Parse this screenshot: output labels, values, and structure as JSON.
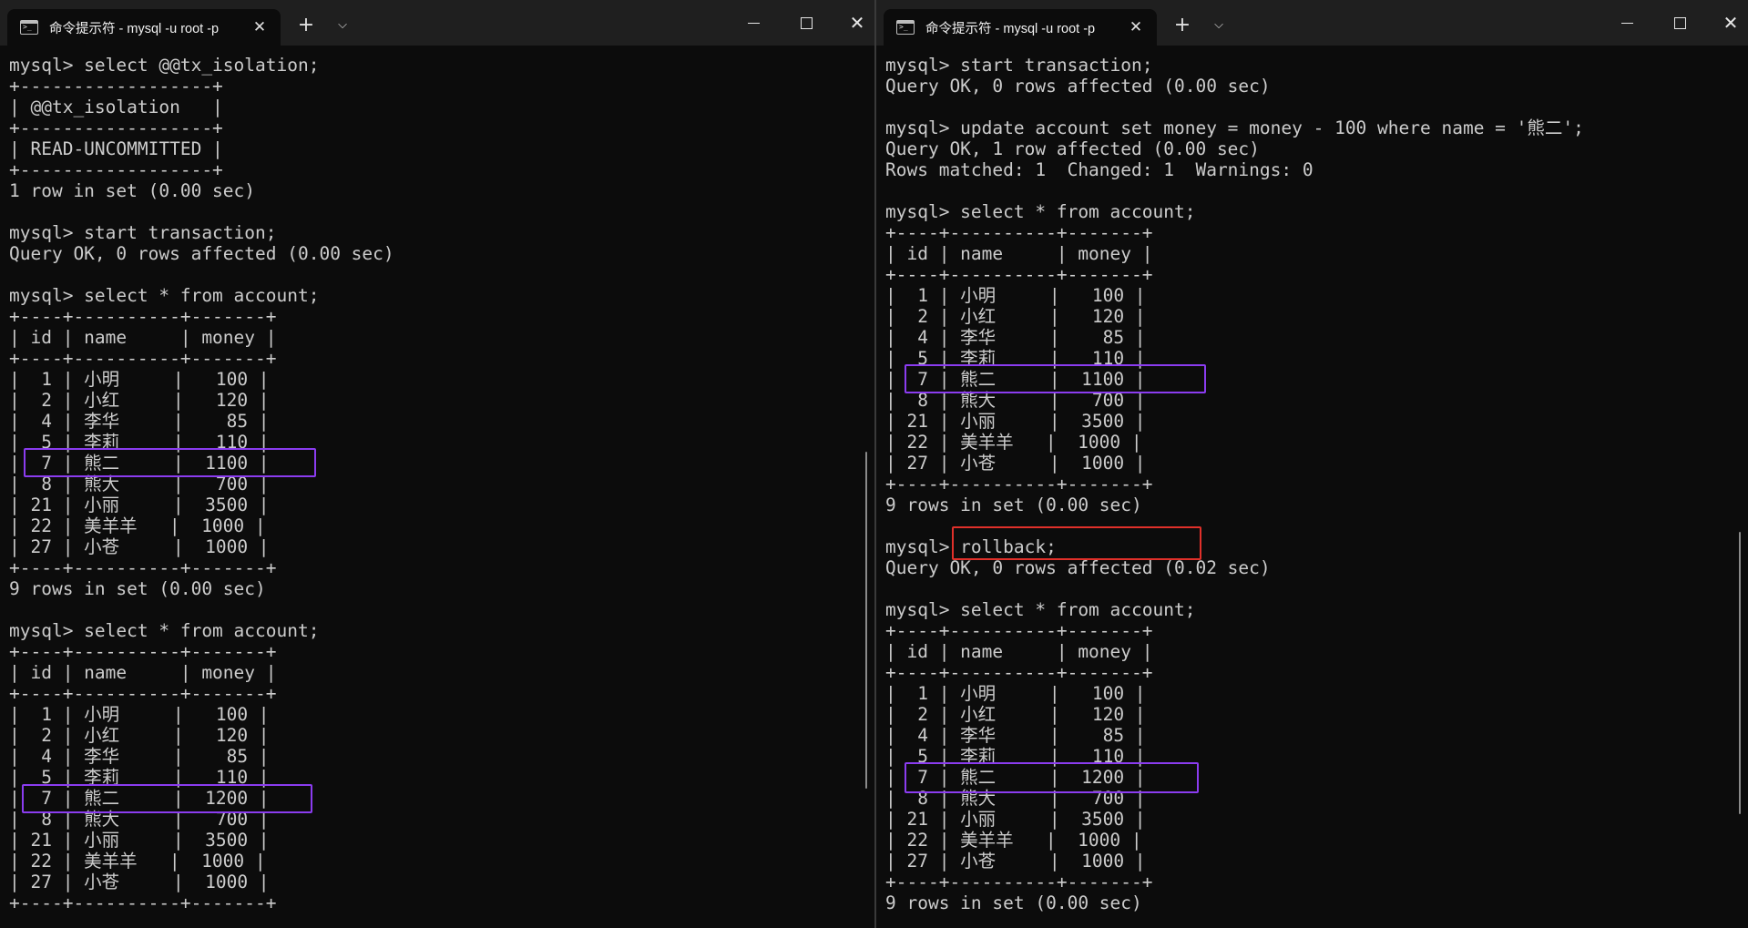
{
  "left_window": {
    "tab_title": "命令提示符 - mysql  -u root -p",
    "lines": [
      "mysql> select @@tx_isolation;",
      "+------------------+",
      "| @@tx_isolation   |",
      "+------------------+",
      "| READ-UNCOMMITTED |",
      "+------------------+",
      "1 row in set (0.00 sec)",
      "",
      "mysql> start transaction;",
      "Query OK, 0 rows affected (0.00 sec)",
      "",
      "mysql> select * from account;",
      "+----+----------+-------+",
      "| id | name     | money |",
      "+----+----------+-------+",
      "|  1 | 小明     |   100 |",
      "|  2 | 小红     |   120 |",
      "|  4 | 李华     |    85 |",
      "|  5 | 李莉     |   110 |",
      "|  7 | 熊二     |  1100 |",
      "|  8 | 熊大     |   700 |",
      "| 21 | 小丽     |  3500 |",
      "| 22 | 美羊羊   |  1000 |",
      "| 27 | 小苍     |  1000 |",
      "+----+----------+-------+",
      "9 rows in set (0.00 sec)",
      "",
      "mysql> select * from account;",
      "+----+----------+-------+",
      "| id | name     | money |",
      "+----+----------+-------+",
      "|  1 | 小明     |   100 |",
      "|  2 | 小红     |   120 |",
      "|  4 | 李华     |    85 |",
      "|  5 | 李莉     |   110 |",
      "|  7 | 熊二     |  1200 |",
      "|  8 | 熊大     |   700 |",
      "| 21 | 小丽     |  3500 |",
      "| 22 | 美羊羊   |  1000 |",
      "| 27 | 小苍     |  1000 |",
      "+----+----------+-------+"
    ]
  },
  "right_window": {
    "tab_title": "命令提示符 - mysql  -u root -p",
    "lines": [
      "mysql> start transaction;",
      "Query OK, 0 rows affected (0.00 sec)",
      "",
      "mysql> update account set money = money - 100 where name = '熊二';",
      "Query OK, 1 row affected (0.00 sec)",
      "Rows matched: 1  Changed: 1  Warnings: 0",
      "",
      "mysql> select * from account;",
      "+----+----------+-------+",
      "| id | name     | money |",
      "+----+----------+-------+",
      "|  1 | 小明     |   100 |",
      "|  2 | 小红     |   120 |",
      "|  4 | 李华     |    85 |",
      "|  5 | 李莉     |   110 |",
      "|  7 | 熊二     |  1100 |",
      "|  8 | 熊大     |   700 |",
      "| 21 | 小丽     |  3500 |",
      "| 22 | 美羊羊   |  1000 |",
      "| 27 | 小苍     |  1000 |",
      "+----+----------+-------+",
      "9 rows in set (0.00 sec)",
      "",
      "mysql> rollback;",
      "Query OK, 0 rows affected (0.02 sec)",
      "",
      "mysql> select * from account;",
      "+----+----------+-------+",
      "| id | name     | money |",
      "+----+----------+-------+",
      "|  1 | 小明     |   100 |",
      "|  2 | 小红     |   120 |",
      "|  4 | 李华     |    85 |",
      "|  5 | 李莉     |   110 |",
      "|  7 | 熊二     |  1200 |",
      "|  8 | 熊大     |   700 |",
      "| 21 | 小丽     |  3500 |",
      "| 22 | 美羊羊   |  1000 |",
      "| 27 | 小苍     |  1000 |",
      "+----+----------+-------+",
      "9 rows in set (0.00 sec)"
    ]
  },
  "colors": {
    "terminal_bg": "#0c0c0c",
    "terminal_text": "#cccccc",
    "titlebar_bg": "#1f1f1f",
    "highlight_purple": "#8b3cf0",
    "highlight_red": "#e0302a"
  },
  "icons": {
    "tab_icon": "terminal-icon",
    "new_tab": "plus-icon",
    "tab_dropdown": "chevron-down-icon",
    "minimize": "minimize-icon",
    "maximize": "maximize-icon",
    "close": "close-icon"
  }
}
